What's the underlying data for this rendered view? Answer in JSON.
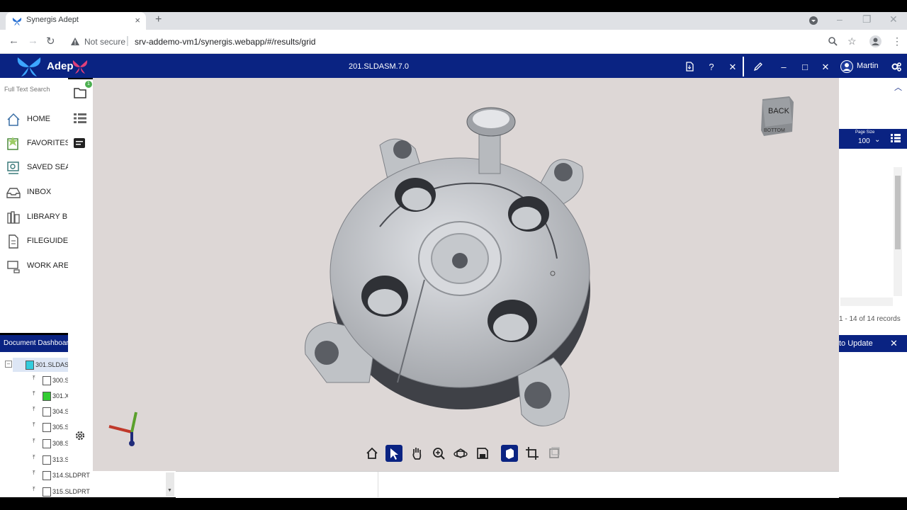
{
  "browser": {
    "tab_title": "Synergis Adept",
    "tab_close": "×",
    "new_tab": "+",
    "security": "Not secure",
    "url": "srv-addemo-vm1/synergis.webapp/#/results/grid"
  },
  "app": {
    "name": "Adep",
    "user": "Martin",
    "search_placeholder": "Full Text Search",
    "badge": "1",
    "nav": [
      {
        "label": "HOME",
        "icon": "home-icon"
      },
      {
        "label": "FAVORITES",
        "icon": "favorites-icon"
      },
      {
        "label": "SAVED SEAI",
        "icon": "saved-search-icon"
      },
      {
        "label": "INBOX",
        "icon": "inbox-icon"
      },
      {
        "label": "LIBRARY BI",
        "icon": "library-icon"
      },
      {
        "label": "FILEGUIDE",
        "icon": "fileguide-icon"
      },
      {
        "label": "WORK ARE.",
        "icon": "work-area-icon"
      }
    ],
    "dashboard_title": "Document Dashboard"
  },
  "viewer": {
    "title": "201.SLDASM.7.0",
    "cube_back": "BACK",
    "cube_bottom": "BOTTOM"
  },
  "tree": [
    {
      "label": "301.SLDAS",
      "root": true,
      "color": "#33ccdd"
    },
    {
      "label": "300.S"
    },
    {
      "label": "301.X",
      "color": "#33cc33"
    },
    {
      "label": "304.S"
    },
    {
      "label": "305.S"
    },
    {
      "label": "308.S"
    },
    {
      "label": "313.S"
    },
    {
      "label": "314.SLDPRT"
    },
    {
      "label": "315.SLDPRT"
    }
  ],
  "results": {
    "page_size_label": "Page Size",
    "page_size": "100",
    "records": "1 - 14 of 14 records",
    "update": "to Update"
  },
  "colors": {
    "header": "#0a2382",
    "viewer_bg": "#ddd7d6"
  }
}
